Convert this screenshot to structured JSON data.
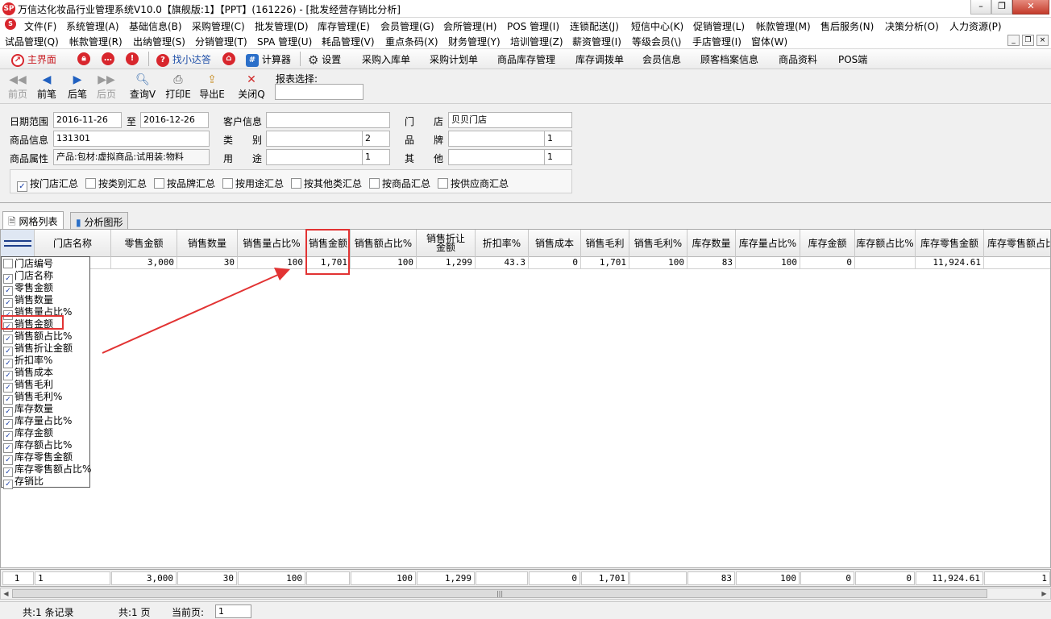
{
  "window": {
    "title": "万信达化妆品行业管理系统V10.0【旗舰版:1】【PPT】(161226) - [批发经营存销比分析]",
    "logo": "SP"
  },
  "menu1": [
    "文件(F)",
    "系统管理(A)",
    "基础信息(B)",
    "采购管理(C)",
    "批发管理(D)",
    "库存管理(E)",
    "会员管理(G)",
    "会所管理(H)",
    "POS 管理(I)",
    "连锁配送(J)",
    "短信中心(K)",
    "促销管理(L)",
    "帐款管理(M)",
    "售后服务(N)",
    "决策分析(O)",
    "人力资源(P)"
  ],
  "menu2": [
    "试品管理(Q)",
    "帐款管理(R)",
    "出纳管理(S)",
    "分销管理(T)",
    "SPA 管理(U)",
    "耗品管理(V)",
    "重点条码(X)",
    "财务管理(Y)",
    "培训管理(Z)",
    "薪资管理(I)",
    "等级会员(\\)",
    "手店管理(I)",
    "窗体(W)"
  ],
  "quickbar": {
    "home": "主界面",
    "find": "找小达答",
    "calc": "计算器",
    "settings": "设置",
    "links": [
      "采购入库单",
      "采购计划单",
      "商品库存管理",
      "库存调拨单",
      "会员信息",
      "顾客档案信息",
      "商品资料",
      "POS端"
    ]
  },
  "toolbar": {
    "first": "前页",
    "prev": "前笔",
    "next": "后笔",
    "last": "后页",
    "query": "查询V",
    "print": "打印E",
    "export": "导出E",
    "close": "关闭Q",
    "report_label": "报表选择:",
    "report_value": ""
  },
  "filter": {
    "date_label": "日期范围",
    "date_from": "2016-11-26",
    "to_label": "至",
    "date_to": "2016-12-26",
    "customer_label": "客户信息",
    "customer_value": "",
    "store_label1": "门",
    "store_label2": "店",
    "store_value": "贝贝门店",
    "product_label": "商品信息",
    "product_value": "131301",
    "category_label1": "类",
    "category_label2": "别",
    "category_value": "",
    "category_count": "2",
    "brand_label1": "品",
    "brand_label2": "牌",
    "brand_value": "",
    "brand_count": "1",
    "attr_label": "商品属性",
    "attr_value": "产品:包材:虚拟商品:试用装:物料",
    "usage_label1": "用",
    "usage_label2": "途",
    "usage_value": "",
    "usage_count": "1",
    "other_label1": "其",
    "other_label2": "他",
    "other_value": "",
    "other_count": "1",
    "groups": [
      {
        "label": "按门店汇总",
        "checked": "✓"
      },
      {
        "label": "按类别汇总",
        "checked": ""
      },
      {
        "label": "按品牌汇总",
        "checked": ""
      },
      {
        "label": "按用途汇总",
        "checked": ""
      },
      {
        "label": "按其他类汇总",
        "checked": ""
      },
      {
        "label": "按商品汇总",
        "checked": ""
      },
      {
        "label": "按供应商汇总",
        "checked": ""
      }
    ]
  },
  "tabs": [
    "网格列表",
    "分析图形"
  ],
  "grid": {
    "headers": [
      "门店名称",
      "零售金额",
      "销售数量",
      "销售量占比%",
      "销售金额",
      "销售额占比%",
      "销售折让金额",
      "折扣率%",
      "销售成本",
      "销售毛利",
      "销售毛利%",
      "库存数量",
      "库存量占比%",
      "库存金额",
      "库存额占比%",
      "库存零售金额",
      "库存零售额占比"
    ],
    "row": [
      "",
      "3,000",
      "30",
      "100",
      "1,701",
      "100",
      "1,299",
      "43.3",
      "0",
      "1,701",
      "100",
      "83",
      "100",
      "0",
      "",
      "11,924.61",
      ""
    ],
    "footer": [
      "1",
      "1",
      "3,000",
      "30",
      "100",
      "",
      "100",
      "1,299",
      "",
      "0",
      "1,701",
      "",
      "83",
      "100",
      "0",
      "0",
      "11,924.61",
      "1"
    ]
  },
  "column_chooser": [
    {
      "label": "门店编号",
      "checked": ""
    },
    {
      "label": "门店名称",
      "checked": "✓"
    },
    {
      "label": "零售金额",
      "checked": "✓"
    },
    {
      "label": "销售数量",
      "checked": "✓"
    },
    {
      "label": "销售量占比%",
      "checked": "✓"
    },
    {
      "label": "销售金额",
      "checked": "✓"
    },
    {
      "label": "销售额占比%",
      "checked": "✓"
    },
    {
      "label": "销售折让金额",
      "checked": "✓"
    },
    {
      "label": "折扣率%",
      "checked": "✓"
    },
    {
      "label": "销售成本",
      "checked": "✓"
    },
    {
      "label": "销售毛利",
      "checked": "✓"
    },
    {
      "label": "销售毛利%",
      "checked": "✓"
    },
    {
      "label": "库存数量",
      "checked": "✓"
    },
    {
      "label": "库存量占比%",
      "checked": "✓"
    },
    {
      "label": "库存金额",
      "checked": "✓"
    },
    {
      "label": "库存额占比%",
      "checked": "✓"
    },
    {
      "label": "库存零售金额",
      "checked": "✓"
    },
    {
      "label": "库存零售额占比%",
      "checked": "✓"
    },
    {
      "label": "存销比",
      "checked": "✓"
    }
  ],
  "status": {
    "records": "共:1 条记录",
    "pages": "共:1 页",
    "current_label": "当前页:",
    "current_page": "1"
  },
  "colors": {
    "highlight": "#e23333",
    "accent": "#d8262d"
  }
}
